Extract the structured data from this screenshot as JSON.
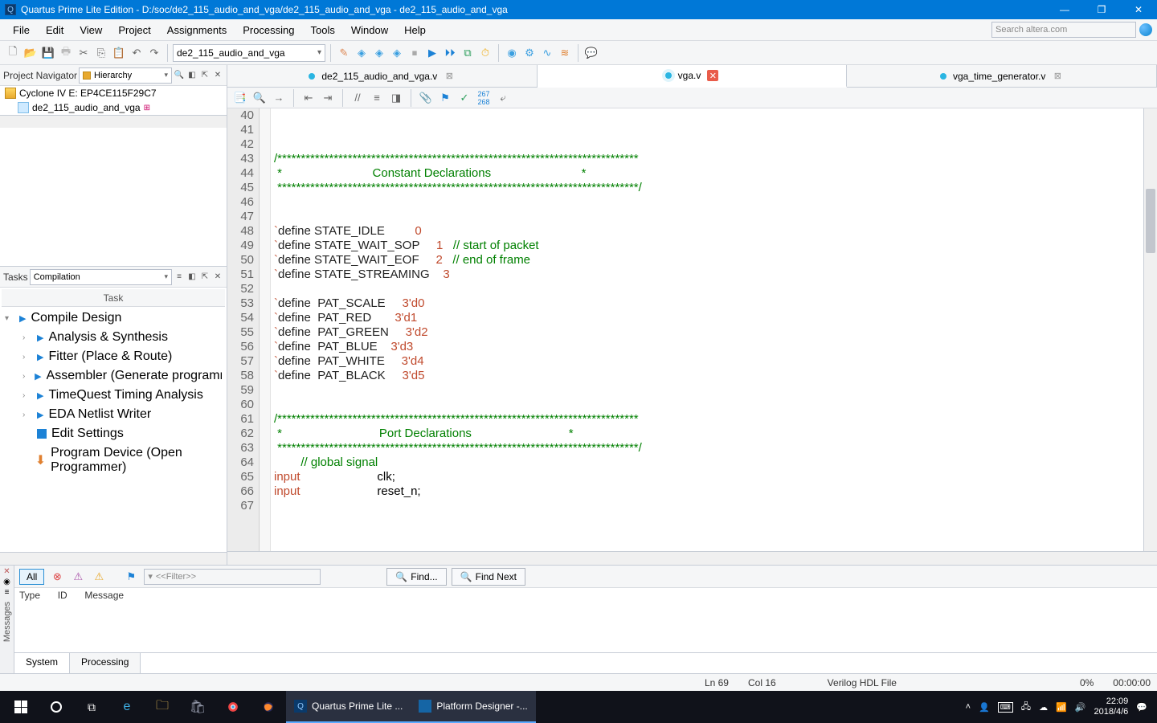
{
  "titlebar": {
    "title": "Quartus Prime Lite Edition - D:/soc/de2_115_audio_and_vga/de2_115_audio_and_vga - de2_115_audio_and_vga"
  },
  "menu": {
    "items": [
      "File",
      "Edit",
      "View",
      "Project",
      "Assignments",
      "Processing",
      "Tools",
      "Window",
      "Help"
    ],
    "search_placeholder": "Search altera.com"
  },
  "toolbar_main": {
    "project_dropdown": "de2_115_audio_and_vga"
  },
  "navigator": {
    "label": "Project Navigator",
    "combo": "Hierarchy",
    "entries": [
      {
        "text": "Cyclone IV E: EP4CE115F29C7",
        "icon": "chip",
        "indent": 0
      },
      {
        "text": "de2_115_audio_and_vga",
        "icon": "block",
        "indent": 1,
        "badge": true
      }
    ]
  },
  "tasks": {
    "label": "Tasks",
    "combo": "Compilation",
    "header": "Task",
    "items": [
      {
        "label": "Compile Design",
        "indent": 0,
        "expanded": true
      },
      {
        "label": "Analysis & Synthesis",
        "indent": 1,
        "chev": true
      },
      {
        "label": "Fitter (Place & Route)",
        "indent": 1,
        "chev": true
      },
      {
        "label": "Assembler (Generate programming files)",
        "indent": 1,
        "chev": true
      },
      {
        "label": "TimeQuest Timing Analysis",
        "indent": 1,
        "chev": true
      },
      {
        "label": "EDA Netlist Writer",
        "indent": 1,
        "chev": true
      },
      {
        "label": "Edit Settings",
        "indent": 1,
        "noplay": true
      },
      {
        "label": "Program Device (Open Programmer)",
        "indent": 1,
        "noplay": true,
        "prog": true
      }
    ]
  },
  "editor": {
    "tabs": [
      {
        "label": "de2_115_audio_and_vga.v",
        "close": "grey",
        "active": false
      },
      {
        "label": "vga.v",
        "close": "red",
        "active": true
      },
      {
        "label": "vga_time_generator.v",
        "close": "grey",
        "active": false
      }
    ],
    "first_line": 40,
    "code_lines": [
      {
        "html": ""
      },
      {
        "html": ""
      },
      {
        "html": ""
      },
      {
        "html": "<span class='c-comment'>/*****************************************************************************</span>"
      },
      {
        "html": "<span class='c-comment'> *                           Constant Declarations                           *</span>"
      },
      {
        "html": "<span class='c-comment'> *****************************************************************************/</span>"
      },
      {
        "html": ""
      },
      {
        "html": ""
      },
      {
        "html": "<span class='c-kw'>`</span><span class='c-define'>define STATE_IDLE         </span><span class='c-num'>0</span>"
      },
      {
        "html": "<span class='c-kw'>`</span><span class='c-define'>define STATE_WAIT_SOP     </span><span class='c-num'>1</span>   <span class='c-comment'>// start of packet</span>"
      },
      {
        "html": "<span class='c-kw'>`</span><span class='c-define'>define STATE_WAIT_EOF     </span><span class='c-num'>2</span>   <span class='c-comment'>// end of frame</span>"
      },
      {
        "html": "<span class='c-kw'>`</span><span class='c-define'>define STATE_STREAMING    </span><span class='c-num'>3</span>"
      },
      {
        "html": ""
      },
      {
        "html": "<span class='c-kw'>`</span><span class='c-define'>define  PAT_SCALE     </span><span class='c-num'>3'd0</span>"
      },
      {
        "html": "<span class='c-kw'>`</span><span class='c-define'>define  PAT_RED       </span><span class='c-num'>3'd1</span>"
      },
      {
        "html": "<span class='c-kw'>`</span><span class='c-define'>define  PAT_GREEN     </span><span class='c-num'>3'd2</span>"
      },
      {
        "html": "<span class='c-kw'>`</span><span class='c-define'>define  PAT_BLUE    </span><span class='c-num'>3'd3</span>"
      },
      {
        "html": "<span class='c-kw'>`</span><span class='c-define'>define  PAT_WHITE     </span><span class='c-num'>3'd4</span>"
      },
      {
        "html": "<span class='c-kw'>`</span><span class='c-define'>define  PAT_BLACK     </span><span class='c-num'>3'd5</span>"
      },
      {
        "html": ""
      },
      {
        "html": ""
      },
      {
        "html": "<span class='c-comment'>/*****************************************************************************</span>"
      },
      {
        "html": "<span class='c-comment'> *                             Port Declarations                             *</span>"
      },
      {
        "html": "<span class='c-comment'> *****************************************************************************/</span>"
      },
      {
        "html": "        <span class='c-comment'>// global signal</span>"
      },
      {
        "html": "<span class='c-kw'>input</span>                       clk;"
      },
      {
        "html": "<span class='c-kw'>input</span>                       reset_n;"
      },
      {
        "html": ""
      }
    ]
  },
  "messages": {
    "all": "All",
    "filter_placeholder": "<<Filter>>",
    "find": "Find...",
    "find_next": "Find Next",
    "columns": {
      "type": "Type",
      "id": "ID",
      "message": "Message"
    },
    "tabs": [
      "System",
      "Processing"
    ]
  },
  "status": {
    "ln": "Ln 69",
    "col": "Col 16",
    "lang": "Verilog HDL File",
    "pct": "0%",
    "time": "00:00:00"
  },
  "taskbar": {
    "apps": [
      {
        "label": "Quartus Prime Lite ...",
        "active": true,
        "icon": "Q"
      },
      {
        "label": "Platform Designer -...",
        "active": true,
        "icon": "P"
      }
    ],
    "time": "22:09",
    "date": "2018/4/6"
  }
}
